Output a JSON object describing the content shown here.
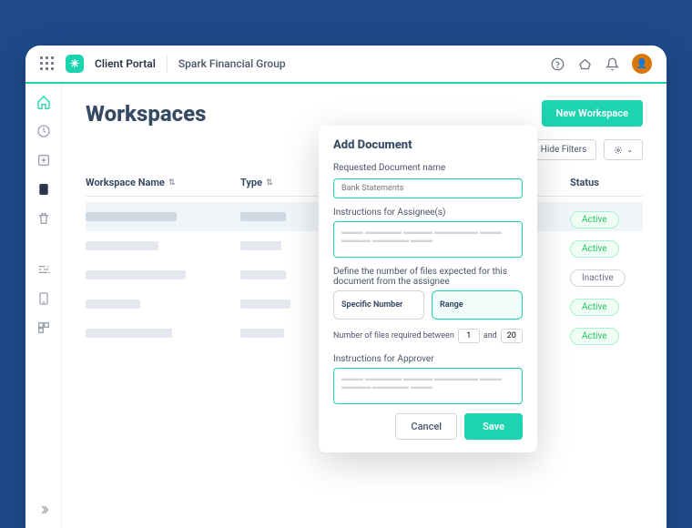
{
  "header": {
    "brand_label": "Client Portal",
    "company_name": "Spark Financial Group"
  },
  "page": {
    "title": "Workspaces",
    "new_workspace_label": "New Workspace",
    "hide_filters_label": "Hide Filters"
  },
  "table": {
    "columns": {
      "name": "Workspace Name",
      "type": "Type",
      "status": "Status"
    },
    "rows": [
      {
        "status": "Active",
        "status_kind": "active"
      },
      {
        "status": "Active",
        "status_kind": "active"
      },
      {
        "status": "Inactive",
        "status_kind": "inactive"
      },
      {
        "status": "Active",
        "status_kind": "active"
      },
      {
        "status": "Active",
        "status_kind": "active"
      }
    ]
  },
  "modal": {
    "title": "Add Document",
    "doc_name_label": "Requested Document name",
    "doc_name_placeholder": "Bank Statements",
    "assignee_instr_label": "Instructions for Assignee(s)",
    "files_expected_label": "Define the number of files expected for this document from the assignee",
    "specific_number_label": "Specific Number",
    "range_label": "Range",
    "range_caption": "Number of files required between",
    "range_and": "and",
    "range_min": "1",
    "range_max": "20",
    "approver_instr_label": "Instructions for Approver",
    "cancel_label": "Cancel",
    "save_label": "Save"
  }
}
